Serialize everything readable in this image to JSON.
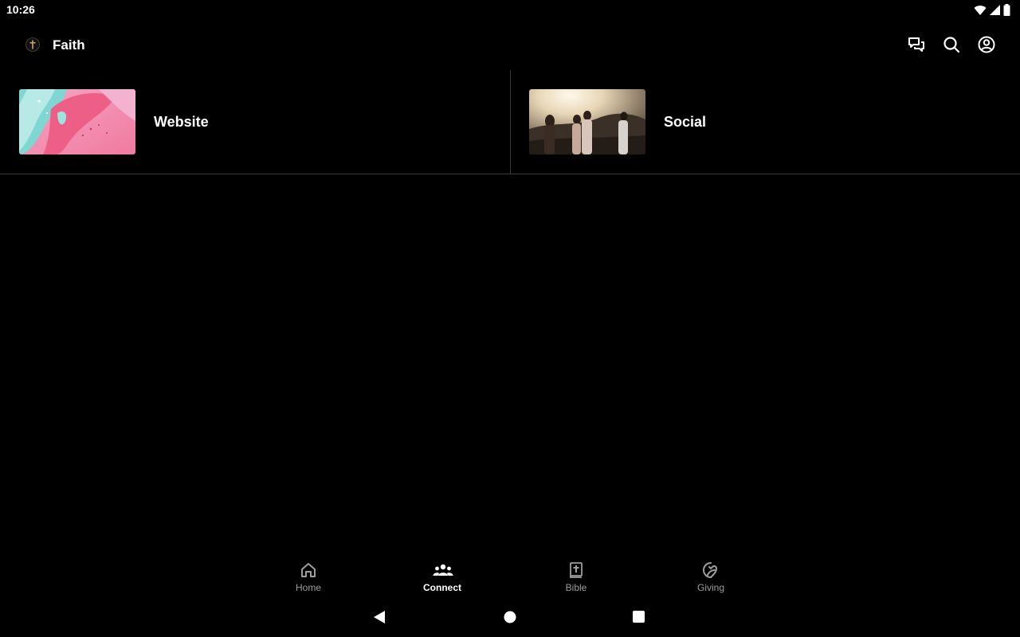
{
  "status_bar": {
    "time": "10:26",
    "icons": [
      "wifi-icon",
      "cell-signal-icon",
      "battery-icon"
    ]
  },
  "app_bar": {
    "title": "Faith",
    "logo_icon": "cross-logo-icon",
    "actions": [
      "chat-icon",
      "search-icon",
      "account-icon"
    ]
  },
  "tiles": [
    {
      "label": "Website",
      "thumb": "pink-teal-abstract-image"
    },
    {
      "label": "Social",
      "thumb": "people-at-sunset-image"
    }
  ],
  "bottom_nav": {
    "items": [
      {
        "label": "Home",
        "icon": "home-icon",
        "active": false
      },
      {
        "label": "Connect",
        "icon": "people-group-icon",
        "active": true
      },
      {
        "label": "Bible",
        "icon": "bible-icon",
        "active": false
      },
      {
        "label": "Giving",
        "icon": "giving-icon",
        "active": false
      }
    ]
  },
  "system_nav": [
    "back-icon",
    "home-circle-icon",
    "recents-icon"
  ],
  "colors": {
    "background": "#000000",
    "divider": "#3a3a3a",
    "inactive_label": "#9e9e9e",
    "active_label": "#ffffff"
  }
}
